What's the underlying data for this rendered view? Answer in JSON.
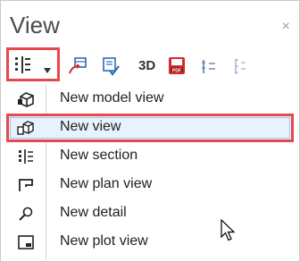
{
  "window": {
    "title": "View",
    "close_glyph": "×"
  },
  "toolbar": {
    "buttons": [
      {
        "icon": "new-view-dropdown-icon"
      },
      {
        "icon": "insert-view-icon"
      },
      {
        "icon": "check-view-icon"
      },
      {
        "label": "3D",
        "icon": "3d-icon"
      },
      {
        "icon": "pdf-export-icon"
      },
      {
        "icon": "view-sort-icon"
      },
      {
        "icon": "view-list-icon"
      }
    ]
  },
  "menu": {
    "items": [
      {
        "label": "New model view",
        "icon": "model-view-icon"
      },
      {
        "label": "New view",
        "icon": "new-view-icon"
      },
      {
        "label": "New section",
        "icon": "section-icon"
      },
      {
        "label": "New plan view",
        "icon": "plan-view-icon"
      },
      {
        "label": "New detail",
        "icon": "detail-icon"
      },
      {
        "label": "New plot view",
        "icon": "plot-view-icon"
      }
    ],
    "selected_index": 1
  },
  "colors": {
    "highlight_border": "#e8474d",
    "selection_bg": "#e8f2fb",
    "pdf_red": "#d42b2b"
  }
}
